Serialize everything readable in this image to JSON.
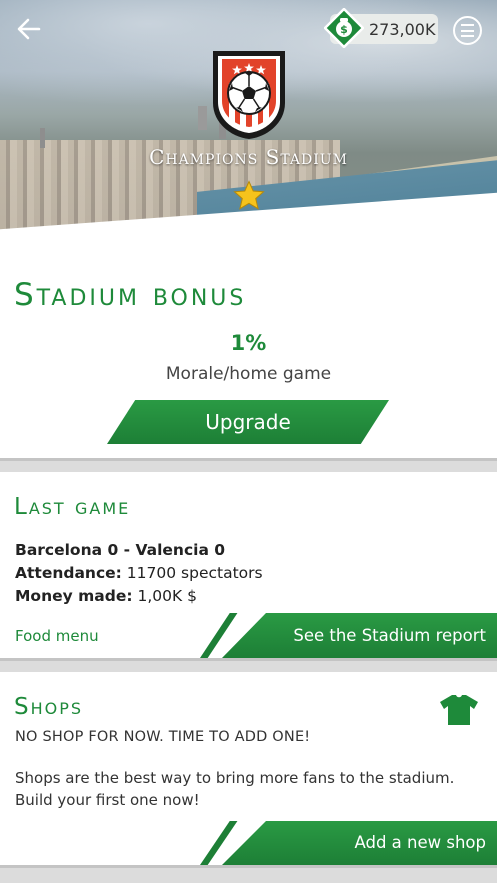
{
  "header": {
    "stadium_name": "Champions Stadium",
    "money": "273,00K"
  },
  "icons": {
    "back": "arrow-left-icon",
    "money": "money-bag-icon",
    "menu": "hamburger-menu-icon",
    "crest": "club-crest-icon",
    "star": "star-icon",
    "shirt": "shirt-icon"
  },
  "stadium_bonus": {
    "title": "Stadium bonus",
    "value": "1%",
    "caption": "Morale/home game",
    "upgrade_label": "Upgrade"
  },
  "last_game": {
    "title": "Last game",
    "match": "Barcelona 0 - Valencia 0",
    "attendance_label": "Attendance:",
    "attendance_value": "11700 spectators",
    "money_label": "Money made:",
    "money_value": "1,00K $",
    "food_menu_label": "Food menu",
    "report_label": "See the Stadium report"
  },
  "shops": {
    "title": "Shops",
    "status": "NO SHOP FOR NOW. TIME TO ADD ONE!",
    "description": "Shops are the best way to bring more fans to the stadium. Build your first one now!",
    "add_label": "Add a new shop"
  },
  "colors": {
    "accent": "#1e8a3a",
    "button": "#2a9a44",
    "background": "#dcdcdc",
    "crest_red": "#e2432a"
  }
}
